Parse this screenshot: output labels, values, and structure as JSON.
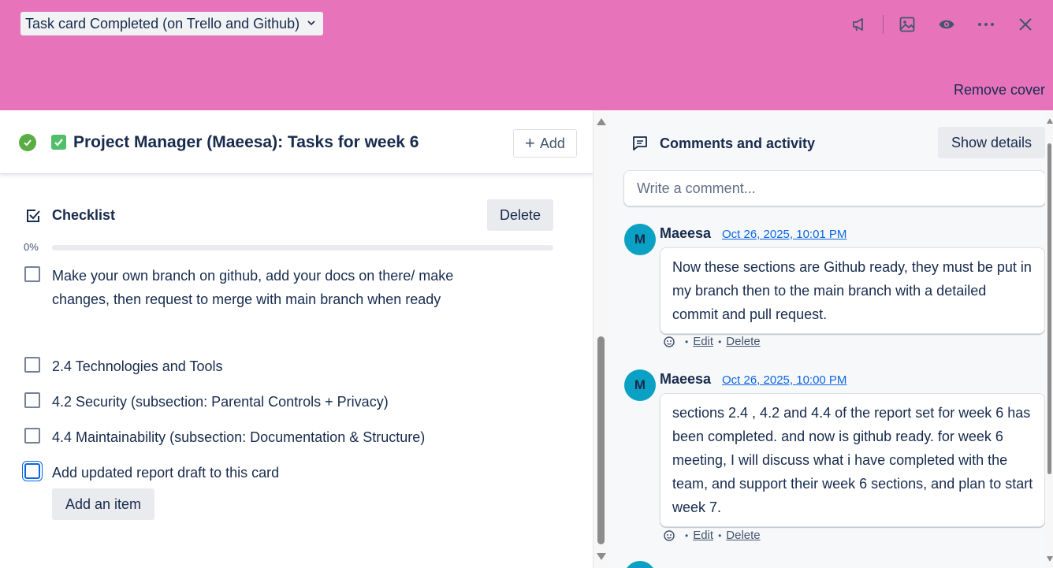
{
  "cover": {
    "color": "#e774bb",
    "list_name": "Task card Completed (on Trello and Github)",
    "remove_cover_label": "Remove cover",
    "actions": [
      "megaphone-icon",
      "image-icon",
      "eye-icon",
      "more-icon",
      "close-icon"
    ]
  },
  "card": {
    "title": "Project Manager (Maeesa): Tasks for week 6",
    "add_label": "Add",
    "complete": true
  },
  "checklist": {
    "title": "Checklist",
    "delete_label": "Delete",
    "progress_label": "0%",
    "progress": 0,
    "items": [
      {
        "text": "Make your own branch on github, add your docs on there/ make changes, then request to merge with main branch when ready",
        "checked": false
      },
      {
        "text": "2.4 Technologies and Tools",
        "checked": false
      },
      {
        "text": "4.2 Security (subsection: Parental Controls + Privacy)",
        "checked": false
      },
      {
        "text": "4.4 Maintainability (subsection: Documentation & Structure)",
        "checked": false
      },
      {
        "text": "Add updated report draft to this card",
        "checked": false
      }
    ],
    "add_item_label": "Add an item"
  },
  "activity": {
    "title": "Comments and activity",
    "show_details_label": "Show details",
    "comment_placeholder": "Write a comment...",
    "comments": [
      {
        "avatar": "M",
        "author": "Maeesa",
        "time": "Oct 26, 2025, 10:01 PM",
        "text": "Now these sections are Github ready, they must be put in my branch then to the main branch with a detailed commit and pull request.",
        "edit_label": "Edit",
        "delete_label": "Delete"
      },
      {
        "avatar": "M",
        "author": "Maeesa",
        "time": "Oct 26, 2025, 10:00 PM",
        "text": "sections 2.4 , 4.2 and 4.4 of the report set for week 6 has been completed. and now is github ready. for week 6 meeting, I will discuss what i have completed with the team, and support their week 6 sections, and plan to start week 7.",
        "edit_label": "Edit",
        "delete_label": "Delete"
      }
    ]
  },
  "colors": {
    "accent": "#0c66e4",
    "avatar": "#0aa1c4",
    "complete": "#5aac44"
  }
}
